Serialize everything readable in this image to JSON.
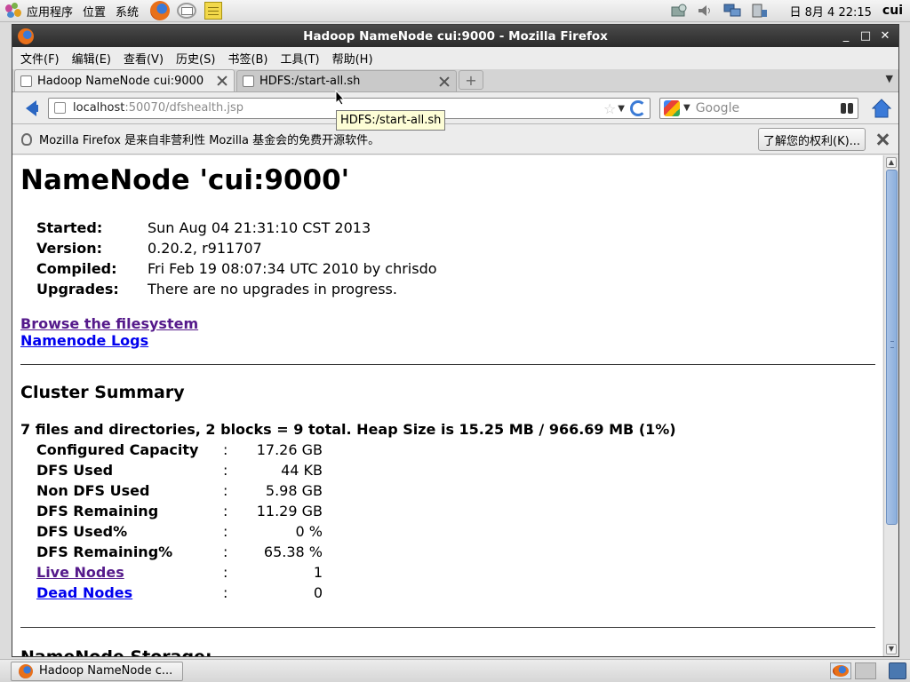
{
  "top_panel": {
    "applications": "应用程序",
    "places": "位置",
    "system": "系统",
    "clock": "日 8月  4 22:15",
    "user": "cui"
  },
  "window": {
    "title": "Hadoop NameNode cui:9000 - Mozilla Firefox",
    "minimize_glyph": "_",
    "maximize_glyph": "□",
    "close_glyph": "✕"
  },
  "menubar": [
    "文件(F)",
    "编辑(E)",
    "查看(V)",
    "历史(S)",
    "书签(B)",
    "工具(T)",
    "帮助(H)"
  ],
  "tabs": [
    {
      "label": "Hadoop NameNode cui:9000",
      "active": true
    },
    {
      "label": "HDFS:/start-all.sh",
      "active": false
    }
  ],
  "navbar": {
    "url_host": "localhost",
    "url_path": ":50070/dfshealth.jsp",
    "search_placeholder": "Google"
  },
  "tooltip": "HDFS:/start-all.sh",
  "notification": {
    "text": "Mozilla Firefox 是来自非营利性 Mozilla 基金会的免费开源软件。",
    "button": "了解您的权利(K)..."
  },
  "page": {
    "heading": "NameNode 'cui:9000'",
    "info": [
      {
        "key": "Started:",
        "value": "Sun Aug 04 21:31:10 CST 2013"
      },
      {
        "key": "Version:",
        "value": "0.20.2, r911707"
      },
      {
        "key": "Compiled:",
        "value": "Fri Feb 19 08:07:34 UTC 2010 by chrisdo"
      },
      {
        "key": "Upgrades:",
        "value": "There are no upgrades in progress."
      }
    ],
    "link_browse": "Browse the filesystem",
    "link_logs": "Namenode Logs",
    "cluster_heading": "Cluster Summary",
    "summary": "7 files and directories, 2 blocks = 9 total. Heap Size is 15.25 MB / 966.69 MB (1%)",
    "stats": [
      {
        "key": "Configured Capacity",
        "sep": ":",
        "value": "17.26 GB"
      },
      {
        "key": "DFS Used",
        "sep": ":",
        "value": "44 KB"
      },
      {
        "key": "Non DFS Used",
        "sep": ":",
        "value": "5.98 GB"
      },
      {
        "key": "DFS Remaining",
        "sep": ":",
        "value": "11.29 GB"
      },
      {
        "key": "DFS Used%",
        "sep": ":",
        "value": "0 %"
      },
      {
        "key": "DFS Remaining%",
        "sep": ":",
        "value": "65.38 %"
      },
      {
        "key": "Live Nodes",
        "sep": ":",
        "value": "1"
      },
      {
        "key": "Dead Nodes",
        "sep": ":",
        "value": "0"
      }
    ],
    "storage_heading": "NameNode Storage:"
  },
  "taskbar": {
    "task_label": "Hadoop NameNode c..."
  }
}
